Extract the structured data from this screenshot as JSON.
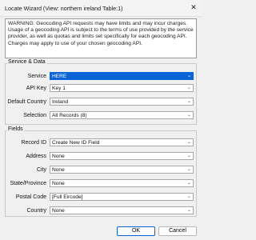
{
  "window": {
    "title": "Locate Wizard (View: northern ireland Table:1)",
    "close_glyph": "✕"
  },
  "warning": "WARNING: Geocoding API requests may have limits and may incur charges. Usage of a geocoding API is subject to the terms of use provided by the service provider, as well as quotas and limits set specifically for each geocoding API. Charges may apply to use of your chosen geocoding API.",
  "service_data": {
    "heading": "Service & Data",
    "rows": [
      {
        "label": "Service",
        "value": "HERE"
      },
      {
        "label": "API Key",
        "value": "Key 1"
      },
      {
        "label": "Default Country",
        "value": "Ireland"
      },
      {
        "label": "Selection",
        "value": "All Records (8)"
      }
    ]
  },
  "fields": {
    "heading": "Fields",
    "rows": [
      {
        "label": "Record ID",
        "value": "Create New ID Field"
      },
      {
        "label": "Address",
        "value": "None"
      },
      {
        "label": "City",
        "value": "None"
      },
      {
        "label": "State/Province",
        "value": "None"
      },
      {
        "label": "Postal Code",
        "value": "[Full Eircode]"
      },
      {
        "label": "Country",
        "value": "None"
      }
    ]
  },
  "buttons": {
    "ok": "OK",
    "cancel": "Cancel"
  },
  "icons": {
    "dropdown": "chevron-down-icon",
    "dropdown_glyph": "⌄"
  },
  "colors": {
    "selected_accent": "#0a64d8"
  }
}
